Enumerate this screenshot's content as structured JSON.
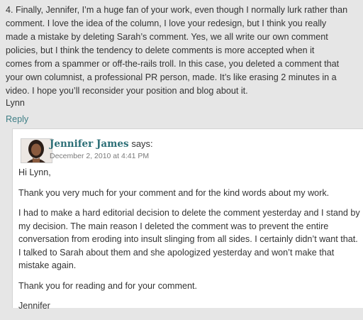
{
  "comment": {
    "text": "4. Finally, Jennifer, I’m a huge fan of your work, even though I normally lurk rather than\ncomment. I love the idea of the column, I love your redesign, but I think you really\nmade a mistake by deleting Sarah’s comment. Yes, we all write our own comment\npolicies, but I think the tendency to delete comments is more accepted when it\ncomes from a spammer or off-the-rails troll. In this case, you deleted a comment that\nyour own columnist, a professional PR person, made. It’s like erasing 2 minutes in a\nvideo. I hope you’ll reconsider your position and blog about it.",
    "signature": "Lynn",
    "reply_label": "Reply"
  },
  "reply": {
    "author": "Jennifer James",
    "says": "says:",
    "date": "December 2, 2010 at 4:41 PM",
    "avatar_icon": "author-avatar",
    "paragraphs": [
      "Hi Lynn,",
      "Thank you very much for your comment and for the kind words about my work.",
      "I had to make a hard editorial decision to delete the comment yesterday and I stand by my decision. The main reason I deleted the comment was to prevent the entire conversation from eroding into insult slinging from all sides. I certainly didn’t want that. I talked to Sarah about them and she apologized yesterday and won’t make that mistake again.",
      "Thank you for reading and for your comment.",
      "Jennifer"
    ]
  },
  "colors": {
    "page_background": "#e6e6e6",
    "reply_background": "#ffffff",
    "link": "#3f7f86",
    "author_name": "#2c6f77",
    "text": "#333333",
    "date": "#7a7a7a"
  }
}
